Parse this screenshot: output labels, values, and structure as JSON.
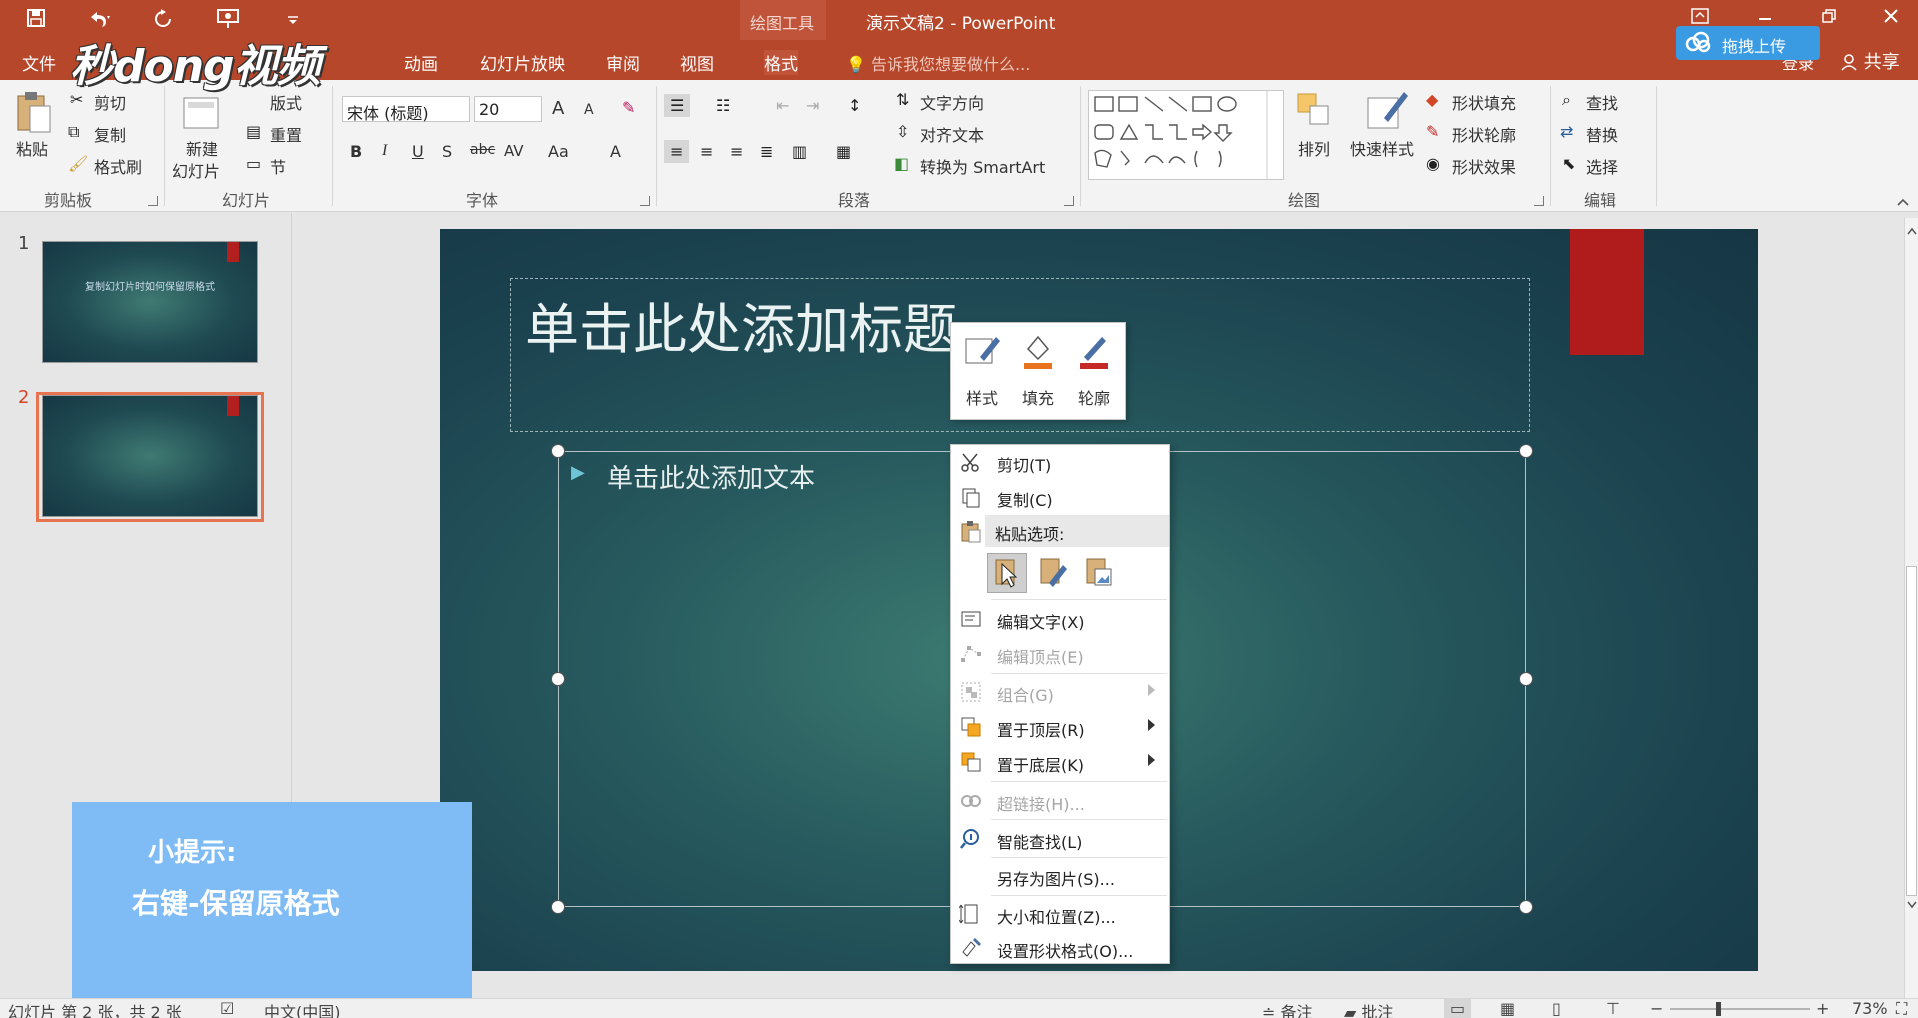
{
  "titlebar": {
    "context_tool_label": "绘图工具",
    "window_title": "演示文稿2 - PowerPoint"
  },
  "logo": {
    "text": "秒dong视频"
  },
  "tabs": [
    {
      "label": "文件"
    },
    {
      "label": "动画"
    },
    {
      "label": "幻灯片放映"
    },
    {
      "label": "审阅"
    },
    {
      "label": "视图"
    },
    {
      "label": "格式",
      "active": true
    }
  ],
  "tellme": {
    "placeholder": "告诉我您想要做什么..."
  },
  "account": {
    "login": "登录",
    "share": "共享"
  },
  "upload": {
    "label": "拖拽上传"
  },
  "ribbon": {
    "clipboard": {
      "paste": "粘贴",
      "cut": "剪切",
      "copy": "复制",
      "format_painter": "格式刷",
      "group": "剪贴板"
    },
    "slides": {
      "new_slide_1": "新建",
      "new_slide_2": "幻灯片",
      "layout": "版式",
      "reset": "重置",
      "section": "节",
      "group": "幻灯片"
    },
    "font": {
      "font_name": "宋体 (标题)",
      "font_size": "20",
      "bold": "B",
      "italic": "I",
      "underline": "U",
      "shadow": "S",
      "strike": "abc",
      "spacing": "AV",
      "case": "Aa",
      "color": "A",
      "grow": "A",
      "shrink": "A",
      "group": "字体"
    },
    "paragraph": {
      "text_direction": "文字方向",
      "align_text": "对齐文本",
      "smartart": "转换为 SmartArt",
      "group": "段落"
    },
    "drawing": {
      "arrange": "排列",
      "quick_styles": "快速样式",
      "shape_fill": "形状填充",
      "shape_outline": "形状轮廓",
      "shape_effects": "形状效果",
      "group": "绘图"
    },
    "editing": {
      "find": "查找",
      "replace": "替换",
      "select": "选择",
      "group": "编辑"
    }
  },
  "slides_pane": {
    "items": [
      {
        "number": "1",
        "title": "复制幻灯片时如何保留原格式"
      },
      {
        "number": "2",
        "title": ""
      }
    ]
  },
  "slide": {
    "title_placeholder": "单击此处添加标题",
    "body_placeholder": "单击此处添加文本"
  },
  "mini_toolbar": {
    "style": "样式",
    "fill": "填充",
    "outline": "轮廓"
  },
  "context_menu": {
    "cut": "剪切(T)",
    "copy": "复制(C)",
    "paste_options": "粘贴选项:",
    "edit_text": "编辑文字(X)",
    "edit_points": "编辑顶点(E)",
    "group": "组合(G)",
    "bring_to_front": "置于顶层(R)",
    "send_to_back": "置于底层(K)",
    "hyperlink": "超链接(H)...",
    "smart_lookup": "智能查找(L)",
    "save_as_picture": "另存为图片(S)...",
    "size_position": "大小和位置(Z)...",
    "format_shape": "设置形状格式(O)..."
  },
  "tip": {
    "title": "小提示:",
    "text": "右键-保留原格式"
  },
  "statusbar": {
    "slide_info": "幻灯片 第 2 张，共 2 张",
    "language": "中文(中国)",
    "notes": "备注",
    "comments": "批注",
    "zoom": "73%"
  },
  "colors": {
    "ppt_red": "#b7472a",
    "slide_dark": "#1b424f",
    "slide_light": "#3d7c72",
    "accent_red": "#b01c1c",
    "tip_blue": "#7fbcf6"
  }
}
